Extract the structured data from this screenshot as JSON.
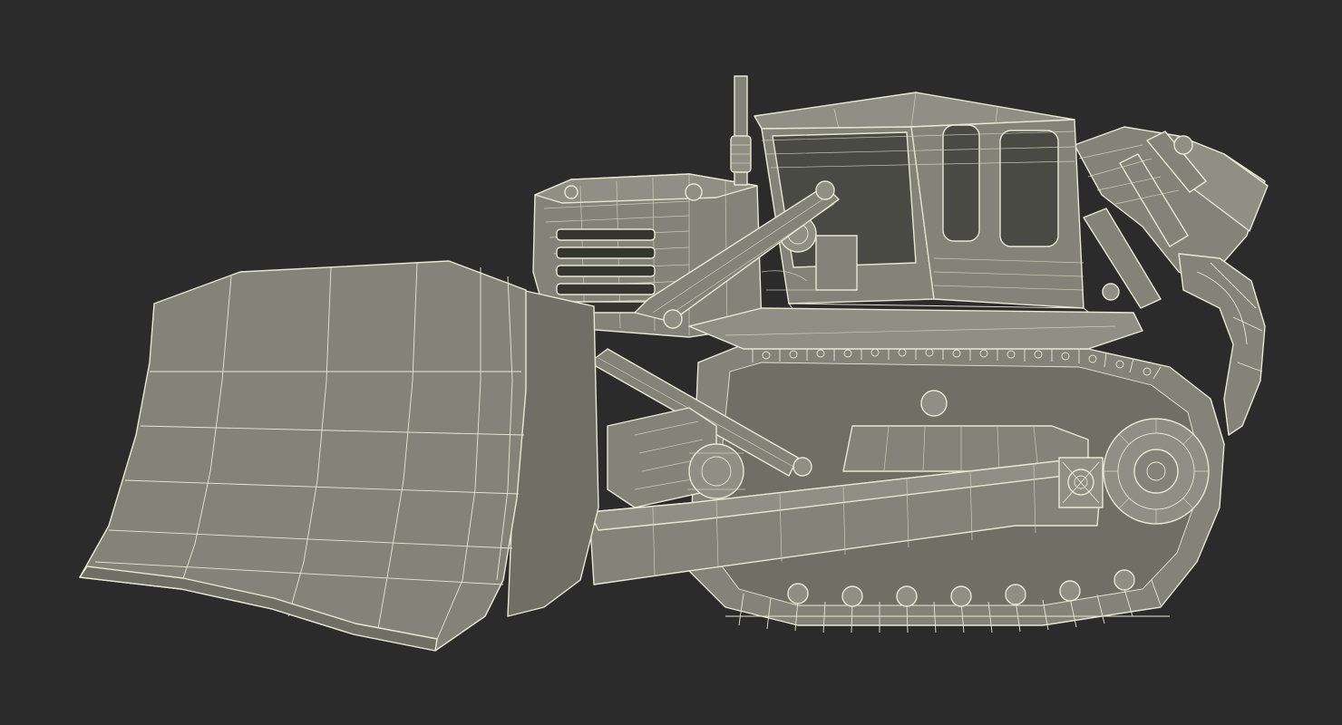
{
  "scene": {
    "subject": "",
    "background_color": "#2b2b2b",
    "model_fill_color": "#83837a",
    "wire_color": "#e8e8d2"
  }
}
